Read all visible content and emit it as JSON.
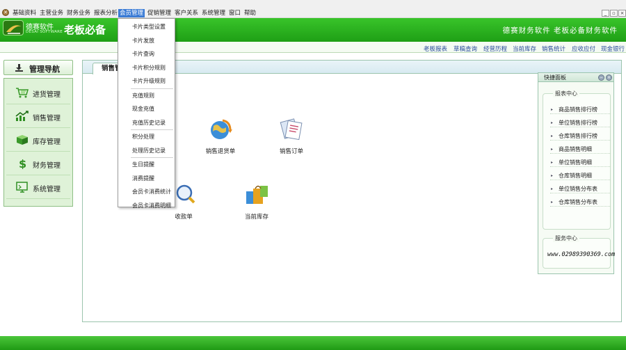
{
  "menu": [
    {
      "label": "基础资料"
    },
    {
      "label": "主营业务"
    },
    {
      "label": "财务业务"
    },
    {
      "label": "报表分析"
    },
    {
      "label": "会员管理"
    },
    {
      "label": "促销管理"
    },
    {
      "label": "客户关系"
    },
    {
      "label": "系统管理"
    },
    {
      "label": "窗口"
    },
    {
      "label": "帮助"
    }
  ],
  "window_controls": {
    "minimize": "_",
    "restore": "▫",
    "close": "×"
  },
  "banner": {
    "logo_cn": "德赛软件",
    "logo_en": "DESAI SOFTWARE",
    "slogan": "老板必备",
    "right_text": "德赛财务软件  老板必备财务软件"
  },
  "quick_links": [
    "老板报表",
    "草稿查询",
    "经营历程",
    "当前库存",
    "销售统计",
    "应收应付",
    "现金银行"
  ],
  "nav": {
    "header": "管理导航",
    "items": [
      {
        "label": "进货管理",
        "icon": "shopping-cart-icon"
      },
      {
        "label": "销售管理",
        "icon": "sales-chart-icon"
      },
      {
        "label": "库存管理",
        "icon": "inventory-box-icon"
      },
      {
        "label": "财务管理",
        "icon": "dollar-icon"
      },
      {
        "label": "系统管理",
        "icon": "monitor-icon"
      }
    ]
  },
  "tab": {
    "label": "销售管理"
  },
  "features": [
    {
      "label": "销售退货单",
      "icon": "globe-return-icon"
    },
    {
      "label": "销售订单",
      "icon": "order-documents-icon"
    },
    {
      "label": "收款单",
      "icon": "magnifier-payment-icon"
    },
    {
      "label": "当前库存",
      "icon": "shopping-bags-icon"
    }
  ],
  "dropdown": {
    "groups": [
      [
        "卡片类型设置",
        "卡片发放",
        "卡片查询",
        "卡片积分规则",
        "卡片升级规则"
      ],
      [
        "充值规则",
        "现金充值",
        "充值历史记录"
      ],
      [
        "积分处理",
        "处理历史记录"
      ],
      [
        "生日提醒",
        "消费提醒",
        "会员卡消费统计",
        "会员卡消费明细"
      ]
    ]
  },
  "quick_panel": {
    "title": "快捷面板",
    "report_center": {
      "title": "报表中心",
      "items": [
        "商品销售排行榜",
        "单位销售排行榜",
        "仓库销售排行榜",
        "商品销售明细",
        "单位销售明细",
        "仓库销售明细",
        "单位销售分布表",
        "仓库销售分布表"
      ]
    },
    "service_center": {
      "title": "服务中心",
      "phone": "www.02989390369.com"
    }
  },
  "colors": {
    "brand_green": "#22a818",
    "menu_active": "#3a7bd5",
    "link_blue": "#2a4d9c"
  }
}
